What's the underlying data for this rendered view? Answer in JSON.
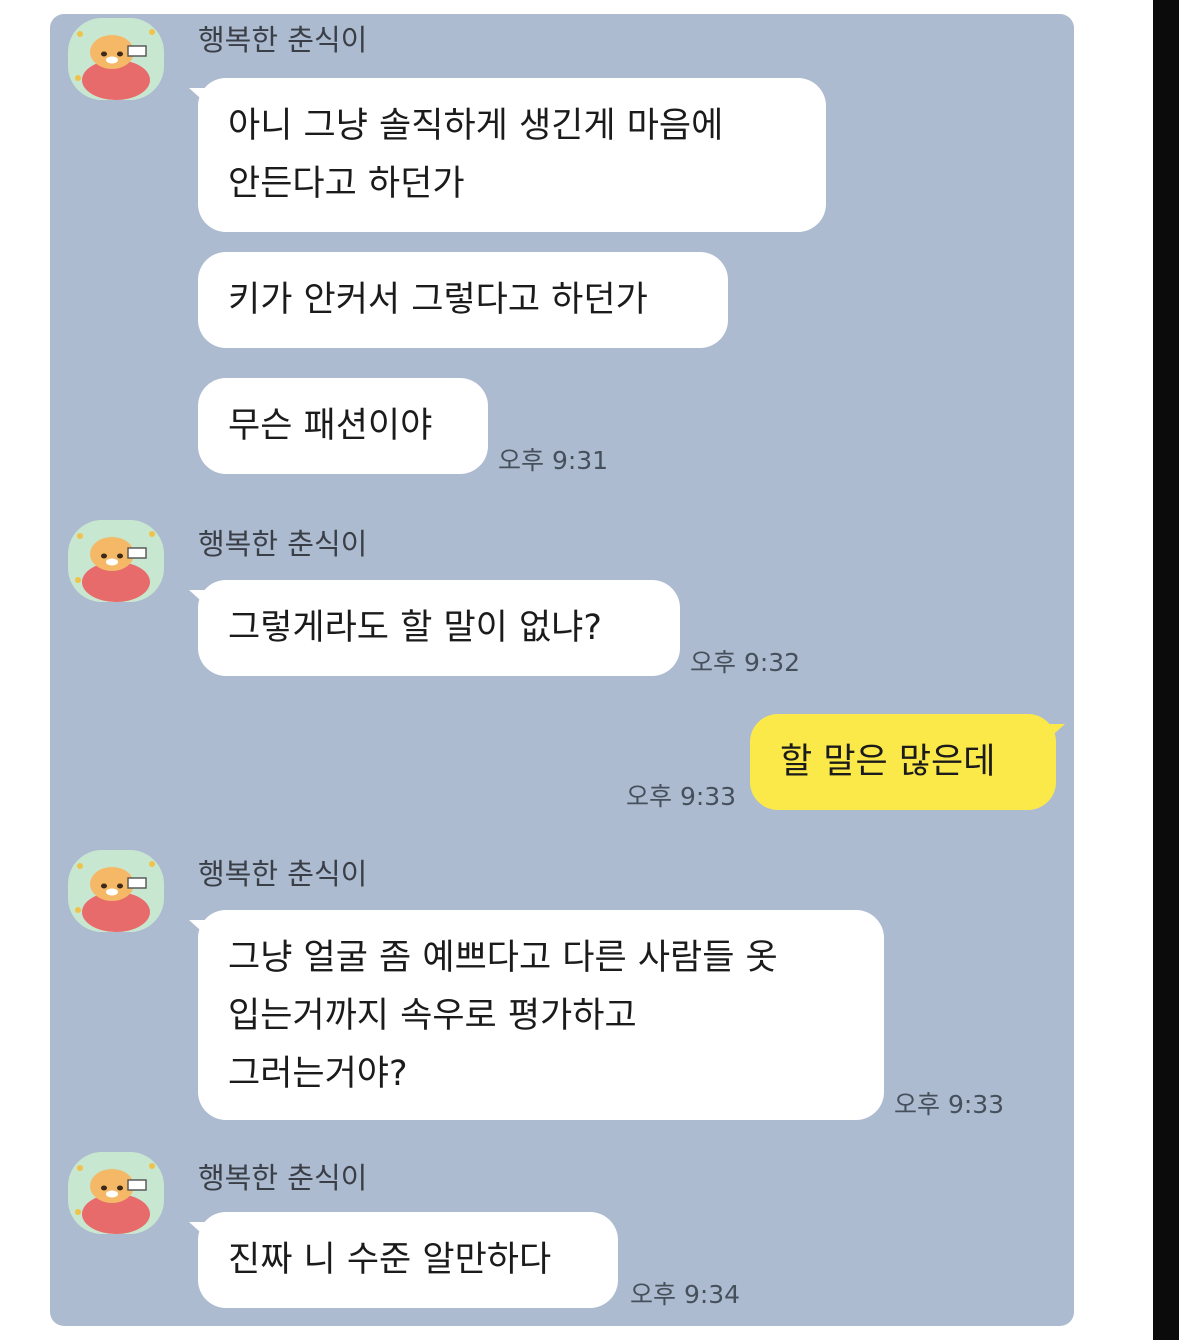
{
  "chat": {
    "groups": [
      {
        "sender": "행복한 춘식이",
        "avatar_icon": "choonsik-sleeping-avatar-icon",
        "messages": [
          {
            "lines": [
              "아니 그냥 솔직하게 생긴게 마음에",
              "안든다고 하던가"
            ]
          },
          {
            "lines": [
              "키가 안커서 그렇다고 하던가"
            ]
          },
          {
            "lines": [
              "무슨 패션이야"
            ],
            "time": "오후 9:31"
          }
        ]
      },
      {
        "sender": "행복한 춘식이",
        "avatar_icon": "choonsik-sleeping-avatar-icon",
        "messages": [
          {
            "lines": [
              "그렇게라도 할 말이 없냐?"
            ],
            "time": "오후 9:32"
          }
        ]
      },
      {
        "sender": "me",
        "messages": [
          {
            "lines": [
              "할 말은 많은데"
            ],
            "time": "오후 9:33"
          }
        ]
      },
      {
        "sender": "행복한 춘식이",
        "avatar_icon": "choonsik-sleeping-avatar-icon",
        "messages": [
          {
            "lines": [
              "그냥 얼굴 좀 예쁘다고 다른 사람들 옷",
              "입는거까지 속우로 평가하고",
              "그러는거야?"
            ],
            "time": "오후 9:33"
          }
        ]
      },
      {
        "sender": "행복한 춘식이",
        "avatar_icon": "choonsik-sleeping-avatar-icon",
        "messages": [
          {
            "lines": [
              "진짜 니 수준 알만하다"
            ],
            "time": "오후 9:34"
          }
        ]
      }
    ]
  },
  "colors": {
    "chat_background": "#adbbd0",
    "incoming_bubble": "#ffffff",
    "outgoing_bubble": "#fbe94a",
    "avatar_background": "#c8e7d0",
    "right_edge": "#0b0b0b"
  }
}
